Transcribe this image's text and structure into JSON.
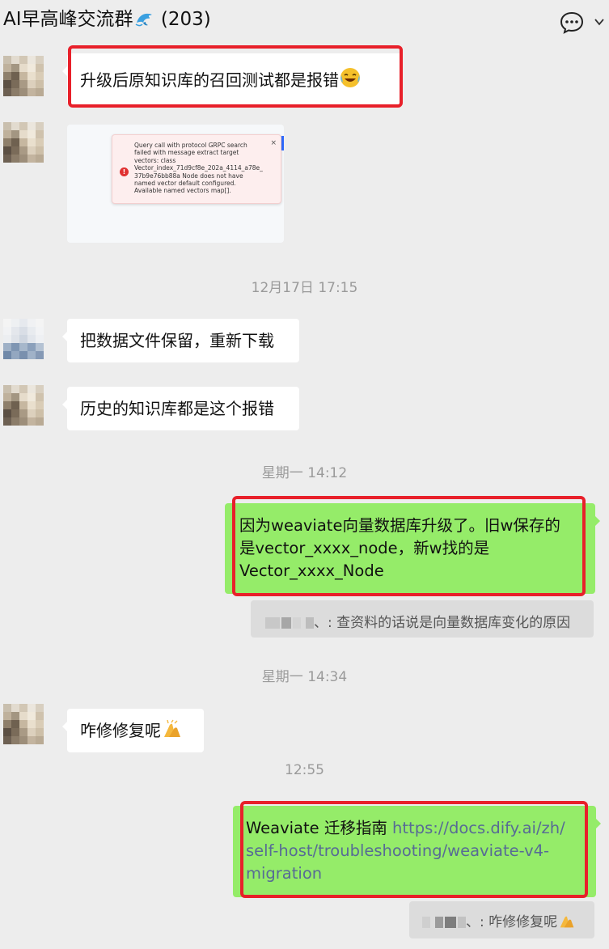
{
  "header": {
    "title": "AI早高峰交流群",
    "member_count": "(203)",
    "title_emoji": "dolphin-icon",
    "more_icon": "chat-more-icon",
    "chevron_icon": "chevron-down-icon"
  },
  "messages": [
    {
      "type": "text",
      "side": "left",
      "text": "升级后原知识库的召回测试都是报错",
      "emoji": "crying-laughing-icon",
      "highlighted": true
    },
    {
      "type": "image",
      "side": "left",
      "image": {
        "error_lines": [
          "Query call with protocol GRPC search",
          "failed with message extract target",
          "vectors: class",
          "Vector_index_71d9cf8e_202a_4114_a78e_",
          "37b9e76bb88a  Node does not have",
          "named vector default configured.",
          "Available named vectors map[]."
        ],
        "close_symbol": "×",
        "error_symbol": "!"
      }
    },
    {
      "type": "time",
      "text": "12月17日 17:15"
    },
    {
      "type": "text",
      "side": "left",
      "text": "把数据文件保留，重新下载"
    },
    {
      "type": "text",
      "side": "left",
      "text": "历史的知识库都是这个报错"
    },
    {
      "type": "time",
      "text": "星期一 14:12"
    },
    {
      "type": "text",
      "side": "right",
      "lines": [
        "因为weaviate向量数据库升级了。旧w保存的",
        "是vector_xxxx_node，新w找的是",
        "Vector_xxxx_Node"
      ],
      "highlighted": true
    },
    {
      "type": "quote",
      "side": "right",
      "text": "、: 查资料的话说是向量数据库变化的原因"
    },
    {
      "type": "time",
      "text": "星期一 14:34"
    },
    {
      "type": "text",
      "side": "left",
      "text": "咋修修复呢",
      "emoji": "praying-hands-icon"
    },
    {
      "type": "time",
      "text": "12:55"
    },
    {
      "type": "text",
      "side": "right",
      "prefix": "Weaviate 迁移指南 ",
      "link_lines": [
        "https://docs.dify.ai/zh/",
        "self-host/troubleshooting/weaviate-v4-",
        "migration"
      ],
      "highlighted": true
    },
    {
      "type": "quote",
      "side": "right",
      "text": "、: 咋修修复呢",
      "emoji": "praying-hands-icon"
    }
  ],
  "colors": {
    "background": "#ededed",
    "my_bubble": "#95ec69",
    "their_bubble": "#ffffff",
    "highlight": "#e8202a",
    "link": "#576b95"
  }
}
